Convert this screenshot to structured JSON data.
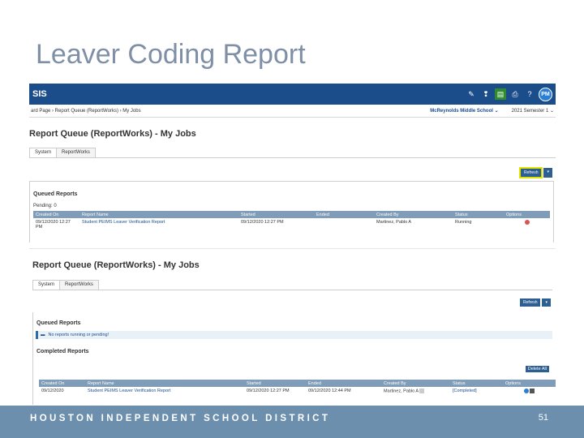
{
  "slide": {
    "title": "Leaver Coding Report",
    "footer": "HOUSTON INDEPENDENT SCHOOL DISTRICT",
    "page_number": "51"
  },
  "shot1": {
    "brand": "SIS",
    "avatar": "PM",
    "breadcrumb": "ard Page  ›  Report Queue (ReportWorks)  ›  My Jobs",
    "school": "McReynolds Middle School  ⌄",
    "term": "2021 Semester 1  ⌄",
    "heading": "Report Queue (ReportWorks) - My Jobs",
    "tabs": [
      "System",
      "ReportWorks"
    ],
    "refresh": "Refresh",
    "dropdown": "▾",
    "queued_title": "Queued Reports",
    "pending": "Pending: 0",
    "columns": [
      "Created On",
      "Report Name",
      "Started",
      "Ended",
      "Created By",
      "Status",
      "Options"
    ],
    "row": {
      "created_on": "09/12/2020 12:27 PM",
      "report_name": "Student PEIMS Leaver Verification Report",
      "started": "09/12/2020 12:27 PM",
      "ended": "",
      "created_by": "Martinez, Pablo A",
      "status": "Running"
    }
  },
  "shot2": {
    "heading": "Report Queue (ReportWorks) - My Jobs",
    "tabs": [
      "System",
      "ReportWorks"
    ],
    "refresh": "Refresh",
    "dropdown": "▾",
    "queued_title": "Queued Reports",
    "info": "No reports running or pending!",
    "completed_title": "Completed Reports",
    "delete_all": "Delete All",
    "columns": [
      "Created On",
      "Report Name",
      "Started",
      "Ended",
      "Created By",
      "Status",
      "Options"
    ],
    "row": {
      "created_on": "09/12/2020",
      "report_name": "Student PEIMS Leaver Verification Report",
      "started": "09/12/2020 12:27 PM",
      "ended": "09/12/2020 12:44 PM",
      "created_by": "Martinez, Pablo A",
      "status": "[Completed]"
    }
  }
}
